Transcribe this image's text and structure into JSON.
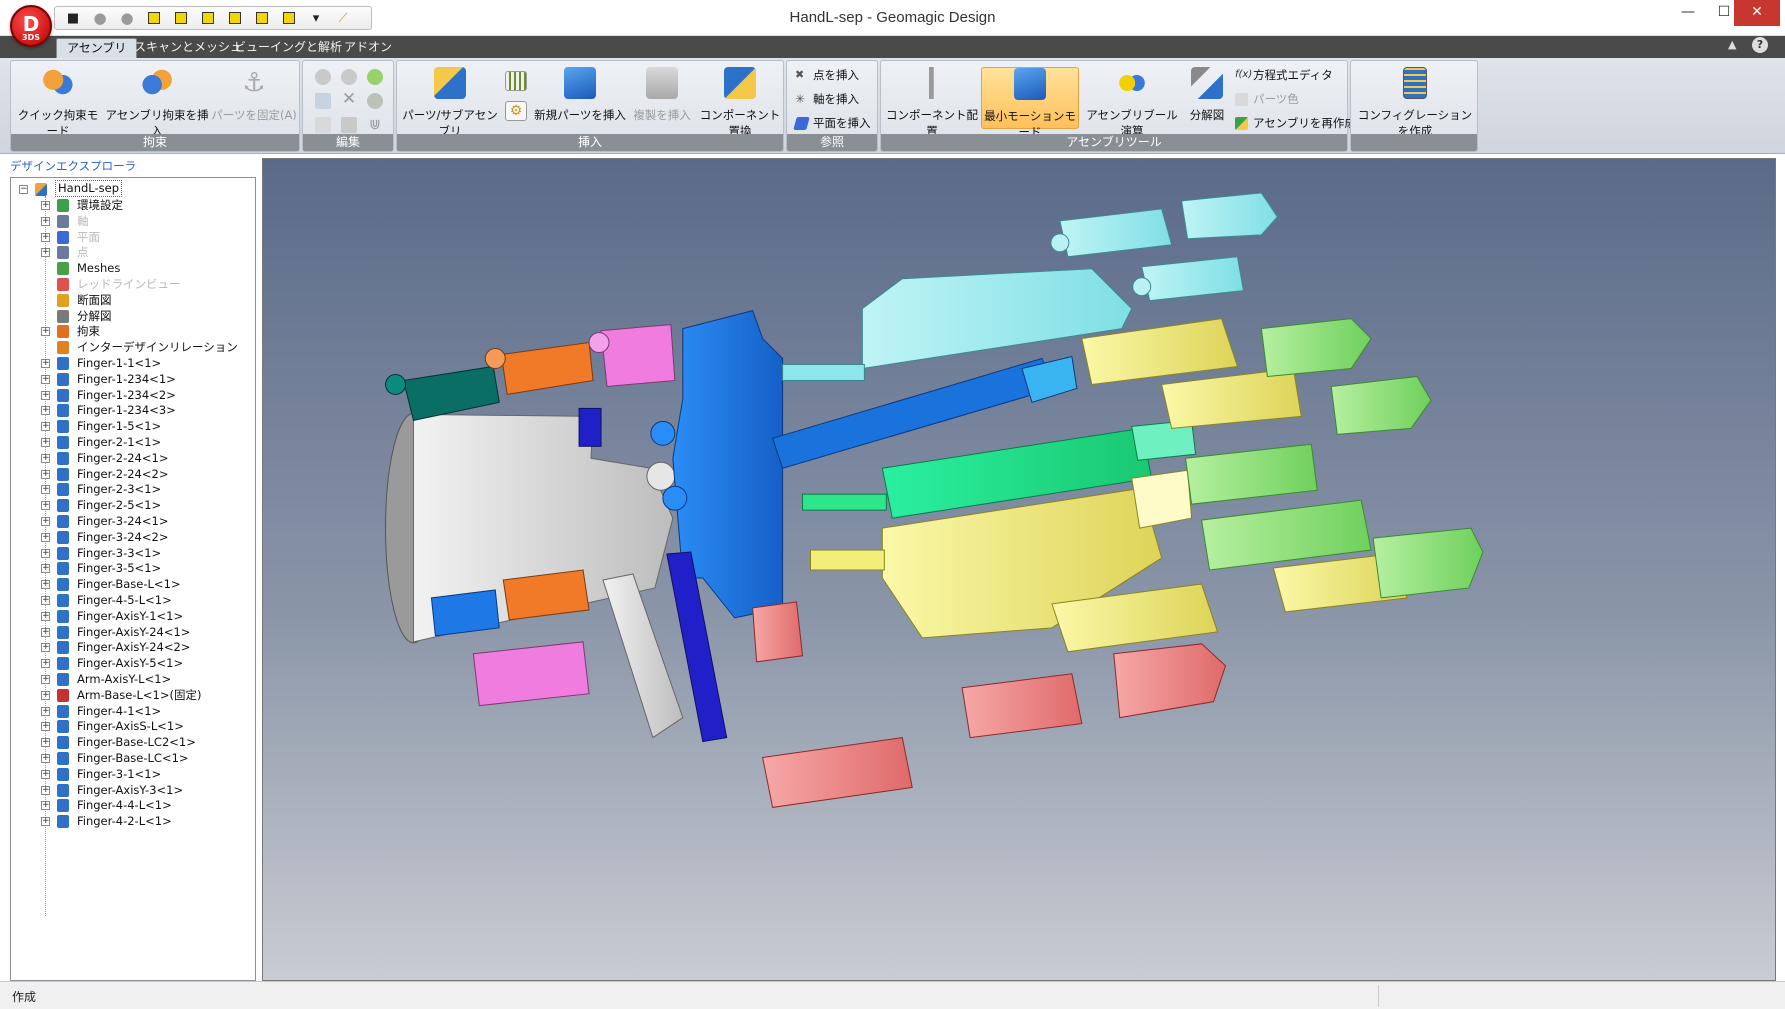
{
  "window": {
    "title": "HandL-sep - Geomagic Design",
    "app_logo": "D",
    "app_logo_sub": "3DS",
    "controls": {
      "minimize": "—",
      "maximize": "☐",
      "close": "✕"
    }
  },
  "quick_access": [
    {
      "name": "save-icon",
      "glyph": "💾"
    },
    {
      "name": "undo-icon",
      "glyph": "●"
    },
    {
      "name": "redo-icon",
      "glyph": "●"
    },
    {
      "name": "view-cube-icon",
      "glyph": "cube"
    },
    {
      "name": "view-cube-icon",
      "glyph": "cube"
    },
    {
      "name": "view-cube-icon",
      "glyph": "cube"
    },
    {
      "name": "view-cube-icon",
      "glyph": "cube"
    },
    {
      "name": "view-cube-icon",
      "glyph": "cube"
    },
    {
      "name": "view-cube-icon",
      "glyph": "cube"
    },
    {
      "name": "dropdown-icon",
      "glyph": "▾"
    },
    {
      "name": "measure-icon",
      "glyph": "/"
    }
  ],
  "tabs": [
    "アセンブリ",
    "スキャンとメッシュ",
    "ビューイングと解析",
    "アドオン"
  ],
  "ribbon": {
    "groups": {
      "constraint": "拘束",
      "edit": "編集",
      "insert": "挿入",
      "reference": "参照",
      "assembly_tools": "アセンブリツール",
      "config": ""
    },
    "buttons": {
      "quick_constraint": "クイック拘束モード",
      "assembly_constraint": "アセンブリ拘束を挿入",
      "fix_part": "パーツを固定(A)",
      "part_subassembly": "パーツ/サブアセンブリ",
      "new_part": "新規パーツを挿入",
      "insert_copy": "複製を挿入",
      "component_replace": "コンポーネント置換",
      "insert_point": "点を挿入",
      "insert_axis": "軸を挿入",
      "insert_plane": "平面を挿入",
      "component_layout": "コンポーネント配置",
      "min_motion": "最小モーションモード",
      "boolean": "アセンブリブール演算",
      "exploded": "分解図",
      "equation_editor": "方程式エディタ",
      "part_color": "パーツ色",
      "rebuild_assembly": "アセンブリを再作成",
      "create_config": "コンフィグレーションを作成"
    }
  },
  "explorer": {
    "title": "デザインエクスプローラ",
    "root": "HandL-sep",
    "items": [
      {
        "label": "環境設定",
        "icon": "environment-icon",
        "color": "#3aa04a",
        "disabled": false,
        "expand": true
      },
      {
        "label": "軸",
        "icon": "axis-icon",
        "color": "#6c7aa0",
        "disabled": true,
        "expand": true
      },
      {
        "label": "平面",
        "icon": "plane-icon",
        "color": "#3b6ad8",
        "disabled": true,
        "expand": true
      },
      {
        "label": "点",
        "icon": "point-icon",
        "color": "#6c7aa0",
        "disabled": true,
        "expand": true
      },
      {
        "label": "Meshes",
        "icon": "mesh-icon",
        "color": "#4aa04a",
        "disabled": false,
        "expand": false
      },
      {
        "label": "レッドラインビュー",
        "icon": "redline-icon",
        "color": "#e05050",
        "disabled": true,
        "expand": false
      },
      {
        "label": "断面図",
        "icon": "section-icon",
        "color": "#e0a020",
        "disabled": false,
        "expand": false
      },
      {
        "label": "分解図",
        "icon": "exploded-icon",
        "color": "#7a7a7a",
        "disabled": false,
        "expand": false
      },
      {
        "label": "拘束",
        "icon": "constraint-icon",
        "color": "#e07020",
        "disabled": false,
        "expand": true
      },
      {
        "label": "インターデザインリレーション",
        "icon": "relation-icon",
        "color": "#e08020",
        "disabled": false,
        "expand": false
      },
      {
        "label": "Finger-1-1<1>",
        "icon": "part-icon",
        "color": "#2d72c8",
        "disabled": false,
        "expand": true
      },
      {
        "label": "Finger-1-234<1>",
        "icon": "part-icon",
        "color": "#2d72c8",
        "disabled": false,
        "expand": true
      },
      {
        "label": "Finger-1-234<2>",
        "icon": "part-icon",
        "color": "#2d72c8",
        "disabled": false,
        "expand": true
      },
      {
        "label": "Finger-1-234<3>",
        "icon": "part-icon",
        "color": "#2d72c8",
        "disabled": false,
        "expand": true
      },
      {
        "label": "Finger-1-5<1>",
        "icon": "part-icon",
        "color": "#2d72c8",
        "disabled": false,
        "expand": true
      },
      {
        "label": "Finger-2-1<1>",
        "icon": "part-icon",
        "color": "#2d72c8",
        "disabled": false,
        "expand": true
      },
      {
        "label": "Finger-2-24<1>",
        "icon": "part-icon",
        "color": "#2d72c8",
        "disabled": false,
        "expand": true
      },
      {
        "label": "Finger-2-24<2>",
        "icon": "part-icon",
        "color": "#2d72c8",
        "disabled": false,
        "expand": true
      },
      {
        "label": "Finger-2-3<1>",
        "icon": "part-icon",
        "color": "#2d72c8",
        "disabled": false,
        "expand": true
      },
      {
        "label": "Finger-2-5<1>",
        "icon": "part-icon",
        "color": "#2d72c8",
        "disabled": false,
        "expand": true
      },
      {
        "label": "Finger-3-24<1>",
        "icon": "part-icon",
        "color": "#2d72c8",
        "disabled": false,
        "expand": true
      },
      {
        "label": "Finger-3-24<2>",
        "icon": "part-icon",
        "color": "#2d72c8",
        "disabled": false,
        "expand": true
      },
      {
        "label": "Finger-3-3<1>",
        "icon": "part-icon",
        "color": "#2d72c8",
        "disabled": false,
        "expand": true
      },
      {
        "label": "Finger-3-5<1>",
        "icon": "part-icon",
        "color": "#2d72c8",
        "disabled": false,
        "expand": true
      },
      {
        "label": "Finger-Base-L<1>",
        "icon": "part-icon",
        "color": "#2d72c8",
        "disabled": false,
        "expand": true
      },
      {
        "label": "Finger-4-5-L<1>",
        "icon": "part-icon",
        "color": "#2d72c8",
        "disabled": false,
        "expand": true
      },
      {
        "label": "Finger-AxisY-1<1>",
        "icon": "part-icon",
        "color": "#2d72c8",
        "disabled": false,
        "expand": true
      },
      {
        "label": "Finger-AxisY-24<1>",
        "icon": "part-icon",
        "color": "#2d72c8",
        "disabled": false,
        "expand": true
      },
      {
        "label": "Finger-AxisY-24<2>",
        "icon": "part-icon",
        "color": "#2d72c8",
        "disabled": false,
        "expand": true
      },
      {
        "label": "Finger-AxisY-5<1>",
        "icon": "part-icon",
        "color": "#2d72c8",
        "disabled": false,
        "expand": true
      },
      {
        "label": "Arm-AxisY-L<1>",
        "icon": "part-icon",
        "color": "#2d72c8",
        "disabled": false,
        "expand": true
      },
      {
        "label": "Arm-Base-L<1>(固定)",
        "icon": "fixed-part-icon",
        "color": "#c83030",
        "disabled": false,
        "expand": true
      },
      {
        "label": "Finger-4-1<1>",
        "icon": "part-icon",
        "color": "#2d72c8",
        "disabled": false,
        "expand": true
      },
      {
        "label": "Finger-AxisS-L<1>",
        "icon": "part-icon",
        "color": "#2d72c8",
        "disabled": false,
        "expand": true
      },
      {
        "label": "Finger-Base-LC2<1>",
        "icon": "part-icon",
        "color": "#2d72c8",
        "disabled": false,
        "expand": true
      },
      {
        "label": "Finger-Base-LC<1>",
        "icon": "part-icon",
        "color": "#2d72c8",
        "disabled": false,
        "expand": true
      },
      {
        "label": "Finger-3-1<1>",
        "icon": "part-icon",
        "color": "#2d72c8",
        "disabled": false,
        "expand": true
      },
      {
        "label": "Finger-AxisY-3<1>",
        "icon": "part-icon",
        "color": "#2d72c8",
        "disabled": false,
        "expand": true
      },
      {
        "label": "Finger-4-4-L<1>",
        "icon": "part-icon",
        "color": "#2d72c8",
        "disabled": false,
        "expand": true
      },
      {
        "label": "Finger-4-2-L<1>",
        "icon": "part-icon",
        "color": "#2d72c8",
        "disabled": false,
        "expand": true
      }
    ]
  },
  "status": {
    "text": "作成"
  },
  "colors": {
    "cyan": "#8ee6ea",
    "blue": "#1e78e6",
    "green": "#2ee68a",
    "lightgreen": "#8fe07a",
    "yellow": "#f2ee7a",
    "red": "#ee8080",
    "grey": "#d8d8d8",
    "orange": "#f07a28",
    "pink": "#f07ce0",
    "teal": "#0a6e64",
    "navy": "#2020c8"
  }
}
